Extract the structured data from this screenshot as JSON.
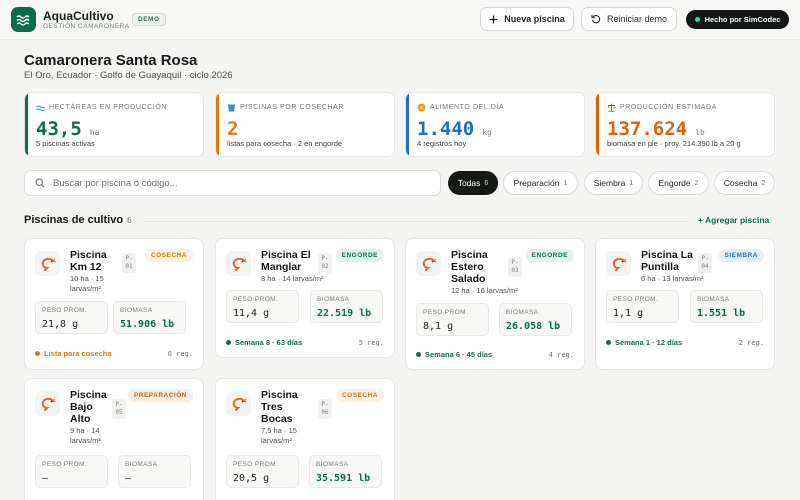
{
  "app": {
    "name": "AquaCultivo",
    "subtitle": "GESTIÓN CAMARONERA",
    "badge": "DEMO"
  },
  "header": {
    "new_pool": "Nueva piscina",
    "reset_demo": "Reiniciar demo",
    "made_by": "Hecho por SimCodec"
  },
  "farm": {
    "title": "Camaronera Santa Rosa",
    "subtitle": "El Oro, Ecuador · Golfo de Guayaquil · ciclo 2026"
  },
  "stats": [
    {
      "label": "HECTÁREAS EN PRODUCCIÓN",
      "value": "43,5",
      "unit": "ha",
      "note": "5 piscinas activas",
      "color": "#0f6b4e",
      "icon": "water-icon"
    },
    {
      "label": "PISCINAS POR COSECHAR",
      "value": "2",
      "unit": "",
      "note": "listas para cosecha · 2 en engorde",
      "color": "#e07b10",
      "icon": "bucket-icon"
    },
    {
      "label": "ALIMENTO DEL DÍA",
      "value": "1.440",
      "unit": "kg",
      "note": "4 registros hoy",
      "color": "#1f6fc4",
      "icon": "feed-icon"
    },
    {
      "label": "PRODUCCIÓN ESTIMADA",
      "value": "137.624",
      "unit": "lb",
      "note": "biomasa en pie · proy. 214.390 lb a 20 g",
      "color": "#d9640f",
      "icon": "scale-icon"
    }
  ],
  "search": {
    "placeholder": "Buscar por piscina o código..."
  },
  "filters": [
    {
      "label": "Todas",
      "count": "6"
    },
    {
      "label": "Preparación",
      "count": "1"
    },
    {
      "label": "Siembra",
      "count": "1"
    },
    {
      "label": "Engorde",
      "count": "2"
    },
    {
      "label": "Cosecha",
      "count": "2"
    }
  ],
  "section": {
    "title": "Piscinas de cultivo",
    "count": "6",
    "add": "+ Agregar piscina"
  },
  "metric_labels": {
    "weight": "PESO PROM.",
    "biomass": "BIOMASA"
  },
  "pools": [
    {
      "name1": "Piscina",
      "name2": "Km 12",
      "name3": "",
      "code1": "P-",
      "code2": "01",
      "meta1": "10 ha · 15",
      "meta2": "larvas/m²",
      "badge": "COSECHA",
      "weight": "21,8 g",
      "biomass": "51.906 lb",
      "status": "Lista para cosecha",
      "status_color": "#e07b10",
      "reg": "6 reg."
    },
    {
      "name1": "Piscina El",
      "name2": "Manglar",
      "name3": "",
      "code1": "P-",
      "code2": "02",
      "meta1": "8 ha · 14 larvas/m²",
      "meta2": "",
      "badge": "ENGORDE",
      "weight": "11,4 g",
      "biomass": "22.519 lb",
      "status": "Semana 8 · 63 días",
      "status_color": "#0f6b4e",
      "reg": "5 reg."
    },
    {
      "name1": "Piscina",
      "name2": "Estero",
      "name3": "Salado",
      "code1": "P-",
      "code2": "03",
      "meta1": "12 ha · 16 larvas/m²",
      "meta2": "",
      "badge": "ENGORDE",
      "weight": "8,1 g",
      "biomass": "26.058 lb",
      "status": "Semana 6 · 45 días",
      "status_color": "#0f6b4e",
      "reg": "4 reg."
    },
    {
      "name1": "Piscina La",
      "name2": "Puntilla",
      "name3": "",
      "code1": "P-",
      "code2": "04",
      "meta1": "6 ha · 13 larvas/m²",
      "meta2": "",
      "badge": "SIEMBRA",
      "weight": "1,1 g",
      "biomass": "1.551 lb",
      "status": "Semana 1 · 12 días",
      "status_color": "#0f6b4e",
      "reg": "2 reg."
    },
    {
      "name1": "Piscina",
      "name2": "Bajo",
      "name3": "Alto",
      "code1": "P-",
      "code2": "05",
      "meta1": "9 ha · 14",
      "meta2": "larvas/m²",
      "badge": "PREPARACIÓN",
      "weight": "—",
      "biomass": "—"
    },
    {
      "name1": "Piscina",
      "name2": "Tres",
      "name3": "Bocas",
      "code1": "P-",
      "code2": "06",
      "meta1": "7,5 ha · 15",
      "meta2": "larvas/m²",
      "badge": "COSECHA",
      "weight": "20,5 g",
      "biomass": "35.591 lb"
    }
  ]
}
